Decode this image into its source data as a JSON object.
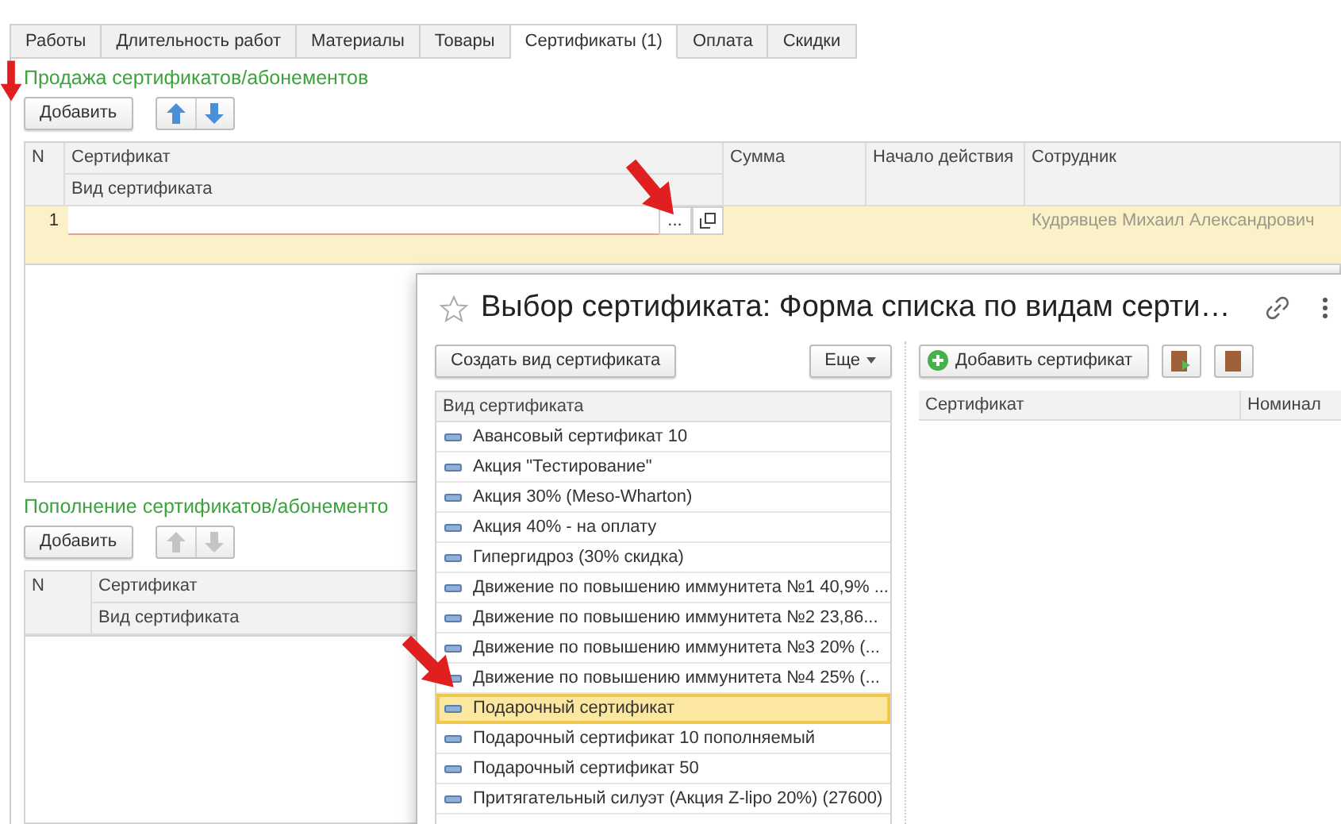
{
  "tabs": [
    {
      "label": "Работы",
      "selected": false
    },
    {
      "label": "Длительность работ",
      "selected": false
    },
    {
      "label": "Материалы",
      "selected": false
    },
    {
      "label": "Товары",
      "selected": false
    },
    {
      "label": "Сертификаты (1)",
      "selected": true
    },
    {
      "label": "Оплата",
      "selected": false
    },
    {
      "label": "Скидки",
      "selected": false
    }
  ],
  "sale": {
    "title": "Продажа сертификатов/абонементов",
    "add_button": "Добавить",
    "move_disabled": false,
    "columns": {
      "n": "N",
      "certificate": "Сертификат",
      "kind": "Вид сертификата",
      "sum": "Сумма",
      "start": "Начало действия",
      "employee": "Сотрудник"
    },
    "rows": [
      {
        "n": "1",
        "choice_button": "...",
        "employee": "Кудрявцев Михаил Александрович",
        "selected": true
      }
    ]
  },
  "topup": {
    "title": "Пополнение сертификатов/абонементо",
    "add_button": "Добавить",
    "move_disabled": true,
    "columns": {
      "n": "N",
      "certificate": "Сертификат",
      "kind": "Вид сертификата"
    }
  },
  "dialog": {
    "title": "Выбор сертификата: Форма списка по видам серти…",
    "create_button": "Создать вид сертификата",
    "more_button": "Еще",
    "add_button": "Добавить сертификат",
    "list_column": "Вид сертификата",
    "items": [
      {
        "label": "Авансовый сертификат 10",
        "selected": false
      },
      {
        "label": "Акция \"Тестирование\"",
        "selected": false
      },
      {
        "label": "Акция 30% (Meso-Wharton)",
        "selected": false
      },
      {
        "label": "Акция 40% - на оплату",
        "selected": false
      },
      {
        "label": "Гипергидроз (30% скидка)",
        "selected": false
      },
      {
        "label": "Движение по повышению иммунитета №1 40,9% ...",
        "selected": false
      },
      {
        "label": "Движение по повышению иммунитета №2 23,86...",
        "selected": false
      },
      {
        "label": "Движение по повышению иммунитета №3 20% (...",
        "selected": false
      },
      {
        "label": "Движение по повышению иммунитета №4 25% (...",
        "selected": false
      },
      {
        "label": "Подарочный сертификат",
        "selected": true
      },
      {
        "label": "Подарочный сертификат 10 пополняемый",
        "selected": false
      },
      {
        "label": "Подарочный сертификат 50",
        "selected": false
      },
      {
        "label": "Притягательный силуэт (Акция Z-lipo 20%) (27600)",
        "selected": false
      }
    ],
    "right_columns": [
      "Сертификат",
      "Номинал"
    ]
  }
}
